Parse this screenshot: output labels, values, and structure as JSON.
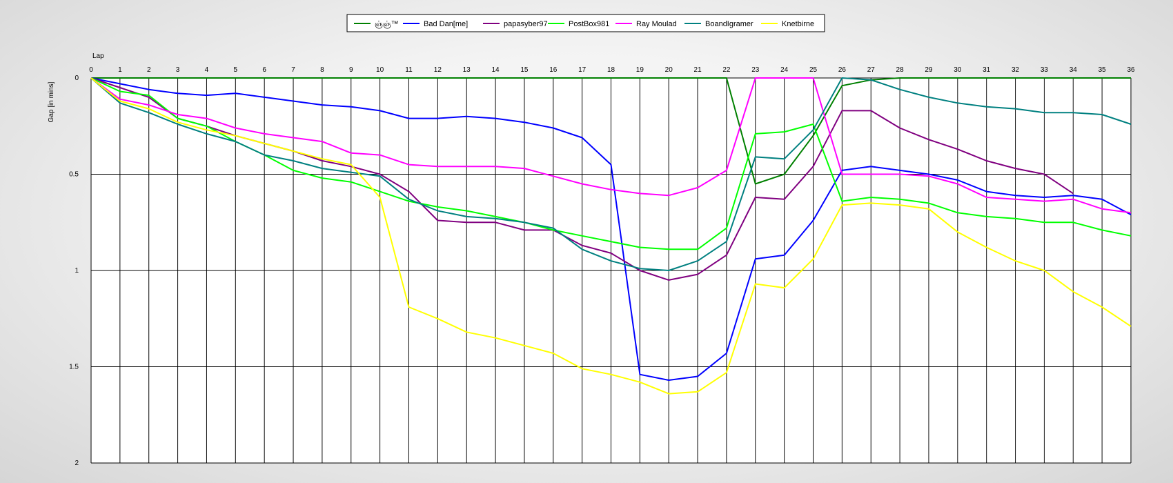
{
  "chart_data": {
    "type": "line",
    "title": "",
    "xlabel": "Lap",
    "ylabel": "Gap [in mins]",
    "xlim": [
      0,
      36
    ],
    "ylim": [
      0,
      2
    ],
    "y_inverted": true,
    "grid": true,
    "legend_position": "top",
    "x": [
      0,
      1,
      2,
      3,
      4,
      5,
      6,
      7,
      8,
      9,
      10,
      11,
      12,
      13,
      14,
      15,
      16,
      17,
      18,
      19,
      20,
      21,
      22,
      23,
      24,
      25,
      26,
      27,
      28,
      29,
      30,
      31,
      32,
      33,
      34,
      35,
      36
    ],
    "x_tick_labels": [
      "0",
      "1",
      "2",
      "3",
      "4",
      "5",
      "6",
      "7",
      "8",
      "9",
      "10",
      "11",
      "12",
      "13",
      "14",
      "15",
      "16",
      "17",
      "18",
      "19",
      "20",
      "21",
      "22",
      "23",
      "24",
      "25",
      "26",
      "27",
      "28",
      "29",
      "30",
      "31",
      "32",
      "33",
      "34",
      "35",
      "36"
    ],
    "y_ticks": [
      0,
      0.5,
      1,
      1.5,
      2
    ],
    "y_tick_labels": [
      "0",
      "0.5",
      "1",
      "1.5",
      "2"
    ],
    "series": [
      {
        "name": "ஞ்ஞ்™",
        "color": "#008000",
        "values": [
          0,
          0,
          0,
          0,
          0,
          0,
          0,
          0,
          0,
          0,
          0,
          0,
          0,
          0,
          0,
          0,
          0,
          0,
          0,
          0,
          0,
          0,
          0,
          0.55,
          0.5,
          0.3,
          0.04,
          0.01,
          0,
          0,
          0,
          0,
          0,
          0,
          0,
          0,
          0
        ],
        "overlay_segments": [
          [
            0,
            0,
            0.07,
            0.09,
            0.22,
            0.26,
            0.31
          ],
          []
        ]
      },
      {
        "name": "Bad Dan[me]",
        "color": "#0000ff",
        "values": [
          0,
          0.03,
          0.06,
          0.08,
          0.09,
          0.08,
          0.1,
          0.12,
          0.14,
          0.15,
          0.17,
          0.21,
          0.21,
          0.2,
          0.21,
          0.23,
          0.26,
          0.31,
          0.45,
          1.54,
          1.57,
          1.55,
          1.43,
          0.94,
          0.92,
          0.74,
          0.48,
          0.46,
          0.48,
          0.5,
          0.53,
          0.59,
          0.61,
          0.62,
          0.61,
          0.63,
          0.71
        ]
      },
      {
        "name": "papasyber97",
        "color": "#800080",
        "values": [
          0,
          0.05,
          0.1,
          0.21,
          0.25,
          0.3,
          0.34,
          0.38,
          0.43,
          0.46,
          0.5,
          0.59,
          0.74,
          0.75,
          0.75,
          0.79,
          0.79,
          0.87,
          0.91,
          1.0,
          1.05,
          1.02,
          0.92,
          0.62,
          0.63,
          0.46,
          0.17,
          0.17,
          0.26,
          0.32,
          0.37,
          0.43,
          0.47,
          0.5,
          0.6,
          null,
          null
        ]
      },
      {
        "name": "PostBox981",
        "color": "#00ff00",
        "values": [
          0,
          0.07,
          0.09,
          0.21,
          0.25,
          0.33,
          0.4,
          0.48,
          0.52,
          0.54,
          0.59,
          0.64,
          0.67,
          0.69,
          0.72,
          0.75,
          0.79,
          0.82,
          0.85,
          0.88,
          0.89,
          0.89,
          0.78,
          0.29,
          0.28,
          0.24,
          0.64,
          0.62,
          0.63,
          0.65,
          0.7,
          0.72,
          0.73,
          0.75,
          0.75,
          0.79,
          0.82
        ]
      },
      {
        "name": "Ray Moulad",
        "color": "#ff00ff",
        "values": [
          0,
          0.11,
          0.14,
          0.19,
          0.21,
          0.26,
          0.29,
          0.31,
          0.33,
          0.39,
          0.4,
          0.45,
          0.46,
          0.46,
          0.46,
          0.47,
          0.51,
          0.55,
          0.58,
          0.6,
          0.61,
          0.57,
          0.48,
          0,
          0,
          0,
          0.5,
          0.5,
          0.5,
          0.51,
          0.55,
          0.62,
          0.63,
          0.64,
          0.63,
          0.68,
          0.7
        ]
      },
      {
        "name": "BoandIgramer",
        "color": "#008080",
        "values": [
          0,
          0.13,
          0.18,
          0.24,
          0.29,
          0.33,
          0.4,
          0.43,
          0.47,
          0.49,
          0.51,
          0.63,
          0.69,
          0.72,
          0.73,
          0.75,
          0.78,
          0.89,
          0.95,
          0.99,
          1.0,
          0.95,
          0.85,
          0.41,
          0.42,
          0.27,
          0,
          0.01,
          0.06,
          0.1,
          0.13,
          0.15,
          0.16,
          0.18,
          0.18,
          0.19,
          0.24
        ]
      },
      {
        "name": "Knetbirne",
        "color": "#ffff00",
        "values": [
          0,
          0.12,
          0.16,
          0.23,
          0.27,
          0.3,
          0.34,
          0.38,
          0.42,
          0.45,
          0.62,
          1.19,
          1.25,
          1.32,
          1.35,
          1.39,
          1.43,
          1.51,
          1.54,
          1.58,
          1.64,
          1.63,
          1.53,
          1.07,
          1.09,
          0.94,
          0.66,
          0.65,
          0.66,
          0.68,
          0.8,
          0.88,
          0.95,
          1.0,
          1.11,
          1.19,
          1.29
        ]
      }
    ]
  }
}
